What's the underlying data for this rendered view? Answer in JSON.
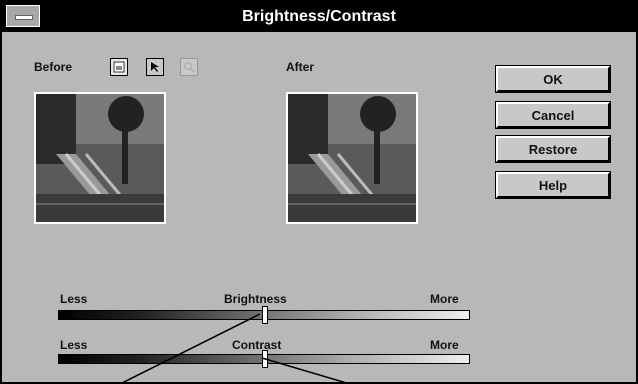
{
  "window": {
    "title": "Brightness/Contrast"
  },
  "before_label": "Before",
  "after_label": "After",
  "tools": [
    {
      "icon": "image-icon",
      "state": "active"
    },
    {
      "icon": "pointer-icon",
      "state": "normal"
    },
    {
      "icon": "zoom-icon",
      "state": "disabled"
    }
  ],
  "buttons": {
    "ok": "OK",
    "cancel": "Cancel",
    "restore": "Restore",
    "help": "Help"
  },
  "sliders": {
    "brightness": {
      "label": "Brightness",
      "less": "Less",
      "more": "More",
      "value_fraction": 0.5
    },
    "contrast": {
      "label": "Contrast",
      "less": "Less",
      "more": "More",
      "value_fraction": 0.5
    }
  }
}
